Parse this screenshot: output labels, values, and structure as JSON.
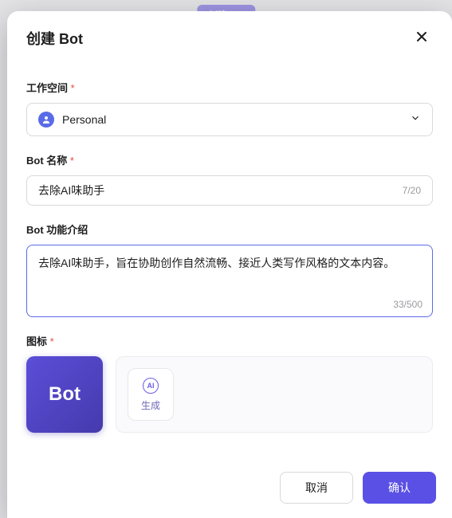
{
  "bgPill": "创建 Bot",
  "modal": {
    "title": "创建 Bot",
    "workspace": {
      "label": "工作空间",
      "selected": "Personal"
    },
    "name": {
      "label": "Bot 名称",
      "value": "去除AI味助手",
      "counter": "7/20"
    },
    "desc": {
      "label": "Bot 功能介绍",
      "value": "去除AI味助手，旨在协助创作自然流畅、接近人类写作风格的文本内容。",
      "counter": "33/500"
    },
    "icon": {
      "label": "图标",
      "previewText": "Bot",
      "genLabel": "生成",
      "genIconText": "AI"
    },
    "footer": {
      "cancel": "取消",
      "confirm": "确认"
    }
  }
}
